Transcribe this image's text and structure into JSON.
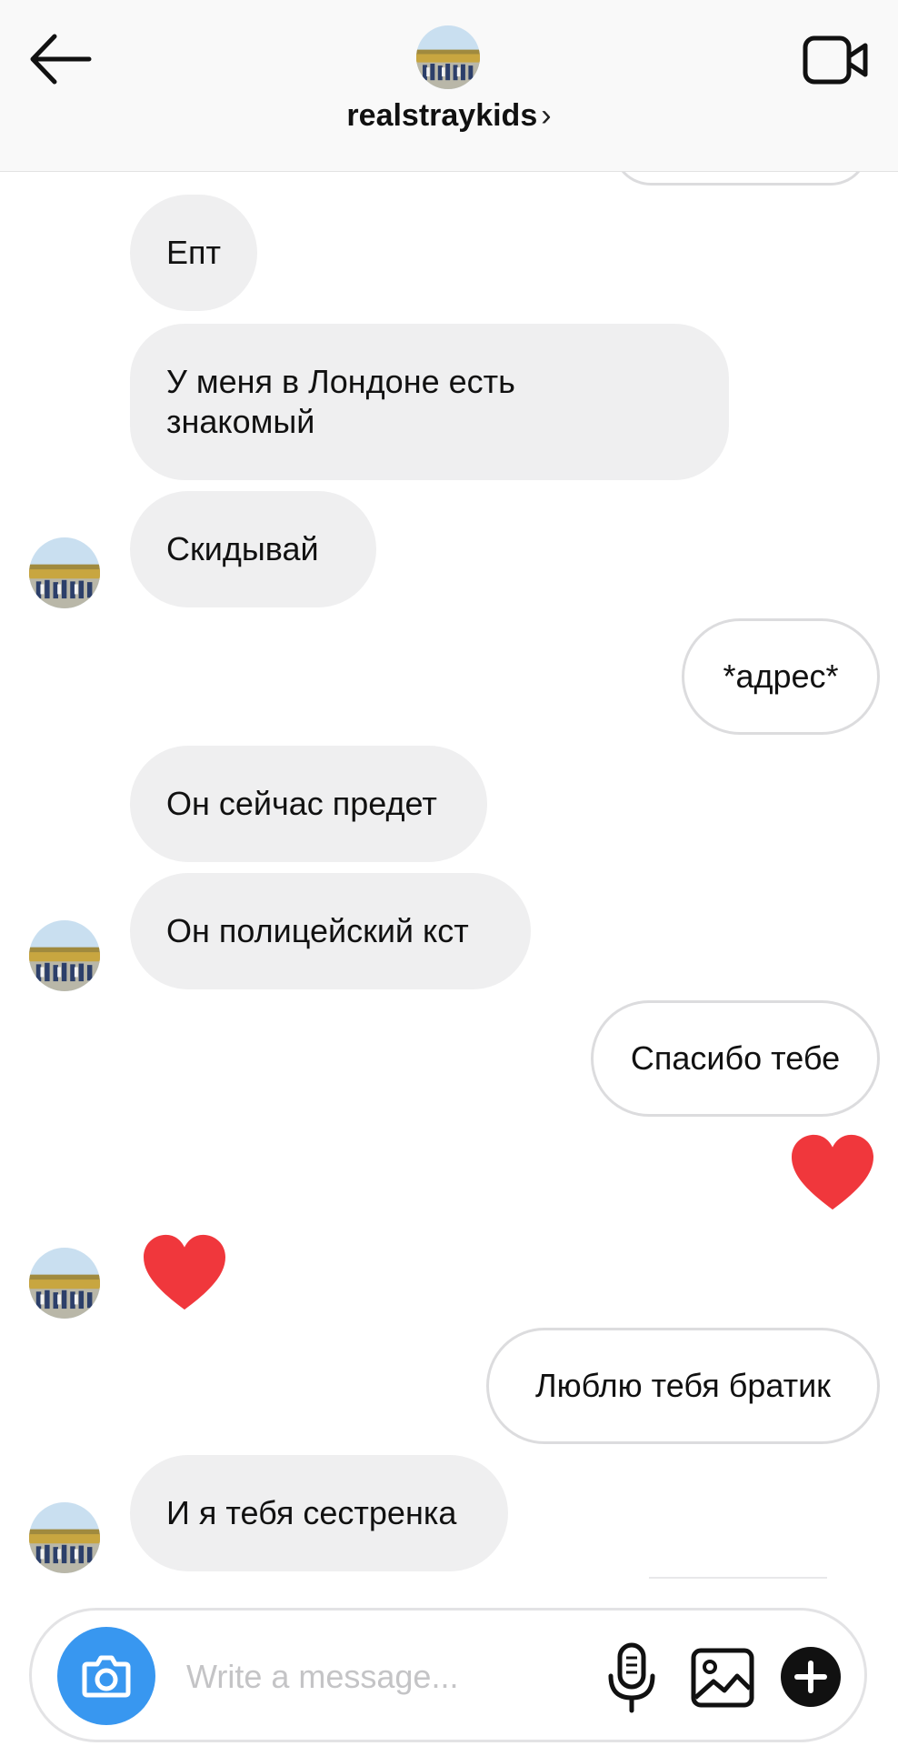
{
  "header": {
    "username": "realstraykids",
    "chevron": "›",
    "icons": {
      "back": "arrow-left-icon",
      "video": "video-camera-icon"
    }
  },
  "messages": [
    {
      "side": "out",
      "type": "partial"
    },
    {
      "side": "in",
      "type": "text",
      "text": "Епт"
    },
    {
      "side": "in",
      "type": "text",
      "text": "У меня в Лондоне есть знакомый"
    },
    {
      "side": "in",
      "type": "text",
      "text": "Скидывай"
    },
    {
      "side": "out",
      "type": "text",
      "text": "*адрес*"
    },
    {
      "side": "in",
      "type": "text",
      "text": "Он сейчас предет"
    },
    {
      "side": "in",
      "type": "text",
      "text": "Он полицейский кст"
    },
    {
      "side": "out",
      "type": "text",
      "text": "Спасибо тебе"
    },
    {
      "side": "out",
      "type": "heart"
    },
    {
      "side": "in",
      "type": "heart"
    },
    {
      "side": "out",
      "type": "text",
      "text": "Люблю тебя братик"
    },
    {
      "side": "in",
      "type": "text",
      "text": "И я тебя сестренка"
    }
  ],
  "composer": {
    "placeholder": "Write a message...",
    "value": "",
    "icons": {
      "camera": "camera-icon",
      "mic": "microphone-icon",
      "gallery": "gallery-icon",
      "more": "plus-icon"
    }
  },
  "colors": {
    "incoming_bubble": "#efeff0",
    "outgoing_border": "#dcdcde",
    "heart": "#f0373c",
    "camera_button": "#3897f0"
  }
}
